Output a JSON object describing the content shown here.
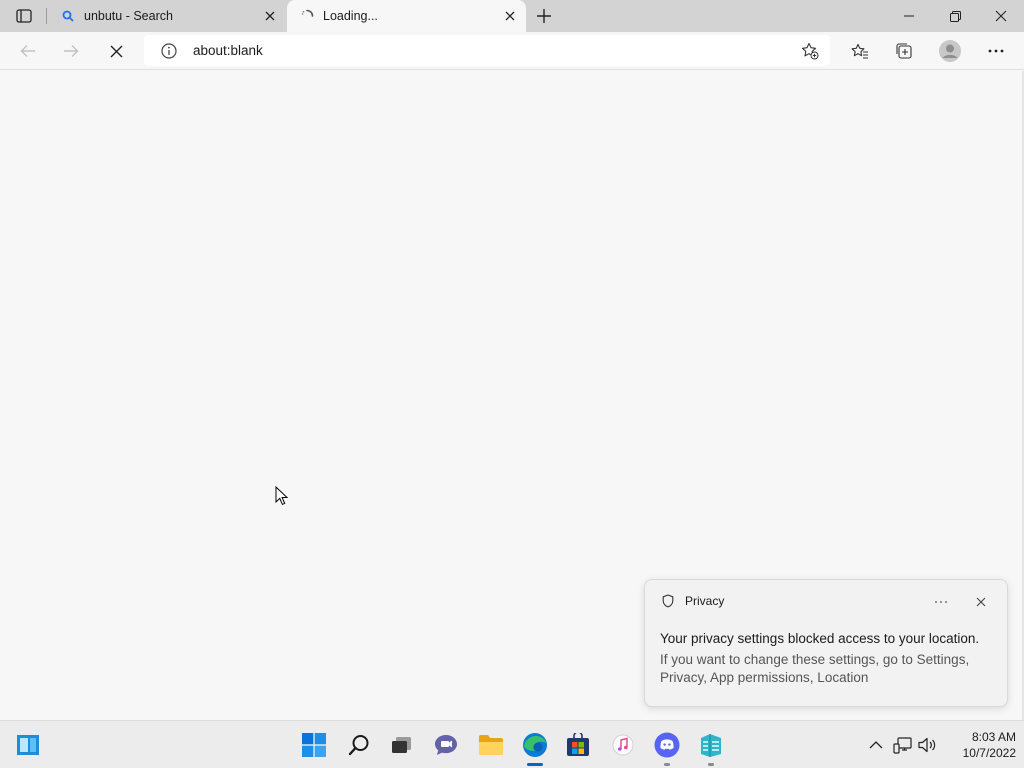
{
  "tabs": [
    {
      "title": "unbutu - Search",
      "favicon": "search-icon"
    },
    {
      "title": "Loading...",
      "favicon": "loading-spinner-icon",
      "active": true
    }
  ],
  "address": {
    "url": "about:blank"
  },
  "toast": {
    "title": "Privacy",
    "message": "Your privacy settings blocked access to your location.",
    "detail": "If you want to change these settings, go to Settings, Privacy, App permissions, Location"
  },
  "taskbar": {
    "apps": [
      "widgets",
      "start",
      "search",
      "task-view",
      "teams-chat",
      "file-explorer",
      "edge",
      "microsoft-store",
      "itunes",
      "discord",
      "app"
    ]
  },
  "clock": {
    "time": "8:03 AM",
    "date": "10/7/2022"
  },
  "colors": {
    "accent": "#0067c0",
    "search_blue": "#1a73e8",
    "discord": "#5865f2"
  }
}
